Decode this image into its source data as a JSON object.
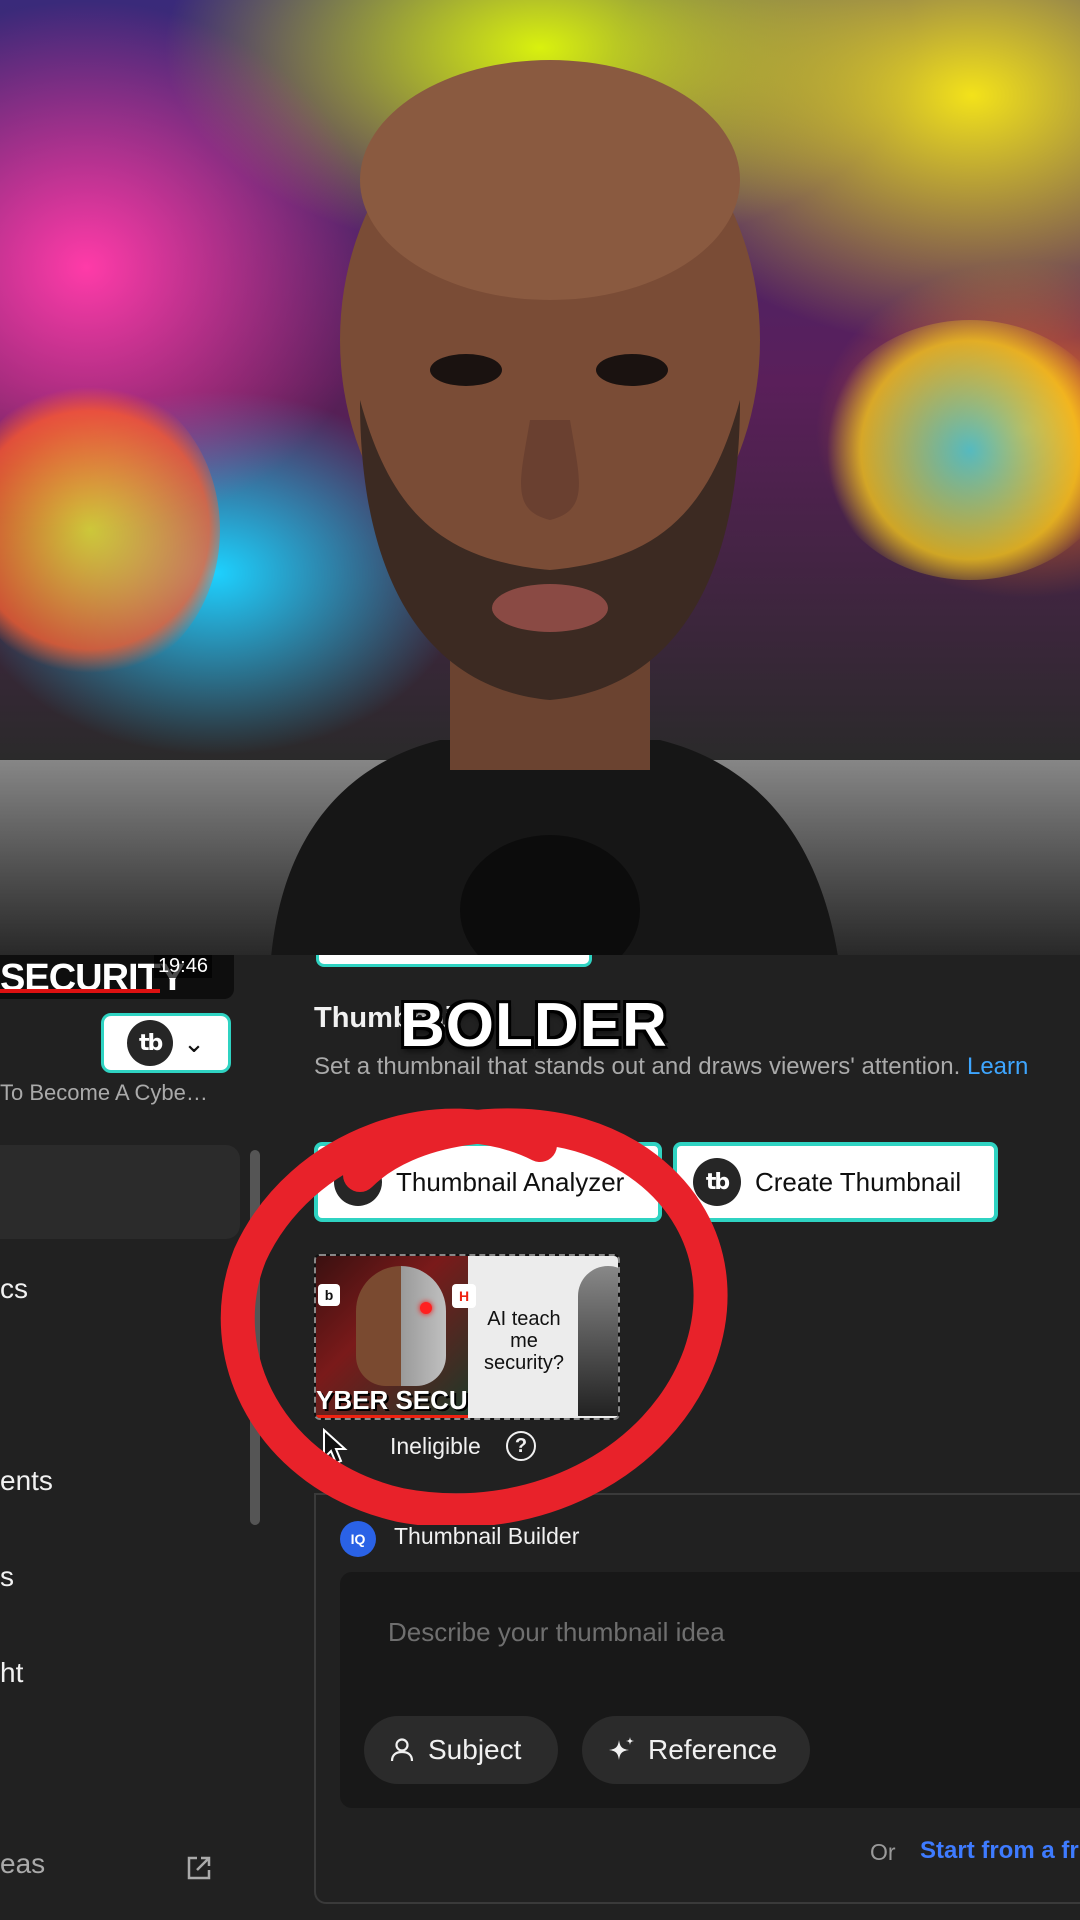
{
  "video_overlay": {
    "strip_title": "SECURITY",
    "duration": "19:46",
    "caption": "BOLDER"
  },
  "sidebar": {
    "video_title": "To Become A Cybe…",
    "items": [
      {
        "label": "cs"
      },
      {
        "label": "ents"
      },
      {
        "label": "s"
      },
      {
        "label": "ht"
      }
    ],
    "bottom_link": "eas"
  },
  "thumbnail_section": {
    "title": "Thumbnail",
    "description": "Set a thumbnail that stands out and draws viewers' attention.",
    "learn_more": "Learn",
    "analyzer_label": "Thumbnail Analyzer",
    "create_label": "Create Thumbnail",
    "thumb_left_text": "YBER SECUR",
    "thumb_right_text": "AI teach me security?",
    "status": "Ineligible"
  },
  "builder": {
    "title": "Thumbnail Builder",
    "icon_text": "IQ",
    "placeholder": "Describe your thumbnail idea",
    "subject_label": "Subject",
    "reference_label": "Reference",
    "or_text": "Or",
    "start_link": "Start from a fr"
  },
  "colors": {
    "accent_teal": "#2fd3c2",
    "link_blue": "#3ea6ff",
    "annotation_red": "#e8222a"
  }
}
